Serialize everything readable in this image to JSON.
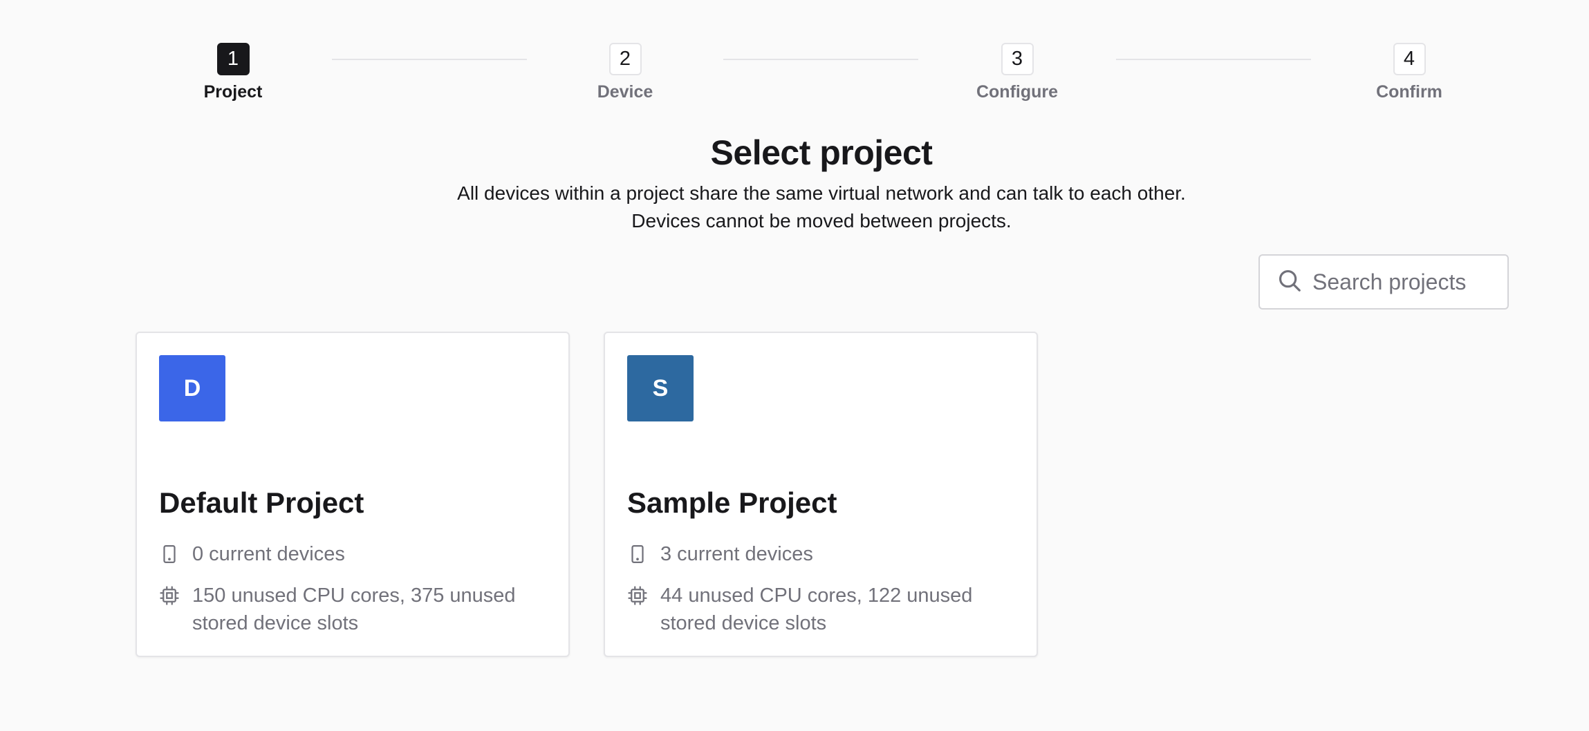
{
  "stepper": {
    "steps": [
      {
        "number": "1",
        "label": "Project",
        "active": true
      },
      {
        "number": "2",
        "label": "Device",
        "active": false
      },
      {
        "number": "3",
        "label": "Configure",
        "active": false
      },
      {
        "number": "4",
        "label": "Confirm",
        "active": false
      }
    ]
  },
  "header": {
    "title": "Select project",
    "subtitle_line1": "All devices within a project share the same virtual network and can talk to each other.",
    "subtitle_line2": "Devices cannot be moved between projects."
  },
  "search": {
    "placeholder": "Search projects",
    "value": ""
  },
  "projects": [
    {
      "initial": "D",
      "name": "Default Project",
      "color": "#3b66e8",
      "devices": "0 current devices",
      "resources": "150 unused CPU cores, 375 unused stored device slots"
    },
    {
      "initial": "S",
      "name": "Sample Project",
      "color": "#2d69a0",
      "devices": "3 current devices",
      "resources": "44 unused CPU cores, 122 unused stored device slots"
    }
  ],
  "icons": {
    "search": "search-icon",
    "device": "phone-icon",
    "cpu": "cpu-chip-icon"
  }
}
